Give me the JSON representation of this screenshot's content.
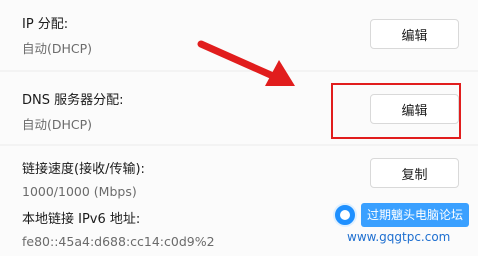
{
  "ip_section": {
    "label": "IP 分配:",
    "value": "自动(DHCP)",
    "button": "编辑"
  },
  "dns_section": {
    "label": "DNS 服务器分配:",
    "value": "自动(DHCP)",
    "button": "编辑"
  },
  "link_section": {
    "speed_label": "链接速度(接收/传输):",
    "speed_value": "1000/1000 (Mbps)",
    "copy_button": "复制",
    "ipv6_label": "本地链接 IPv6 地址:",
    "ipv6_value": "fe80::45a4:d688:cc14:c0d9%2"
  },
  "annotation": {
    "arrow_color": "#e11d1d",
    "highlight_color": "#e11d1d"
  },
  "watermark": {
    "title": "过期魑头电脑论坛",
    "url": "www.gqgtpc.com"
  }
}
